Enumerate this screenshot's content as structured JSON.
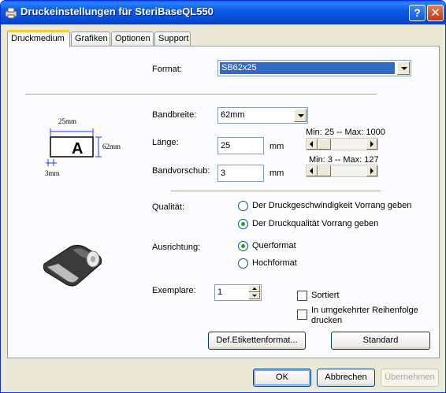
{
  "window": {
    "title": "Druckeinstellungen für SteriBaseQL550",
    "help_label": "?",
    "close_label": "✕"
  },
  "tabs": [
    "Druckmedium",
    "Grafiken",
    "Optionen",
    "Support"
  ],
  "format": {
    "label": "Format:",
    "value": "SB62x25"
  },
  "diagram": {
    "width_text": "25mm",
    "height_text": "62mm",
    "feed_text": "3mm",
    "letter": "A"
  },
  "bandbreite": {
    "label": "Bandbreite:",
    "value": "62mm"
  },
  "laenge": {
    "label": "Länge:",
    "value": "25",
    "unit": "mm",
    "range": "Min: 25 -- Max: 1000"
  },
  "bandvorschub": {
    "label": "Bandvorschub:",
    "value": "3",
    "unit": "mm",
    "range": "Min: 3 -- Max: 127"
  },
  "qualitaet": {
    "label": "Qualität:",
    "options": [
      "Der Druckgeschwindigkeit Vorrang geben",
      "Der Druckqualität Vorrang geben"
    ],
    "selected": 1
  },
  "ausrichtung": {
    "label": "Ausrichtung:",
    "options": [
      "Querformat",
      "Hochformat"
    ],
    "selected": 0
  },
  "exemplare": {
    "label": "Exemplare:",
    "value": "1"
  },
  "sortiert": {
    "label": "Sortiert",
    "checked": false
  },
  "reihenfolge": {
    "label_line1": "In umgekehrter Reihenfolge",
    "label_line2": "drucken",
    "checked": false
  },
  "buttons": {
    "def_format": "Def.Etikettenformat...",
    "standard": "Standard",
    "ok": "OK",
    "cancel": "Abbrechen",
    "apply": "Übernehmen"
  },
  "colors": {
    "titlebar": "#0a5ce8",
    "selection": "#316ac5",
    "dimension_lines": "#1e3cff"
  }
}
